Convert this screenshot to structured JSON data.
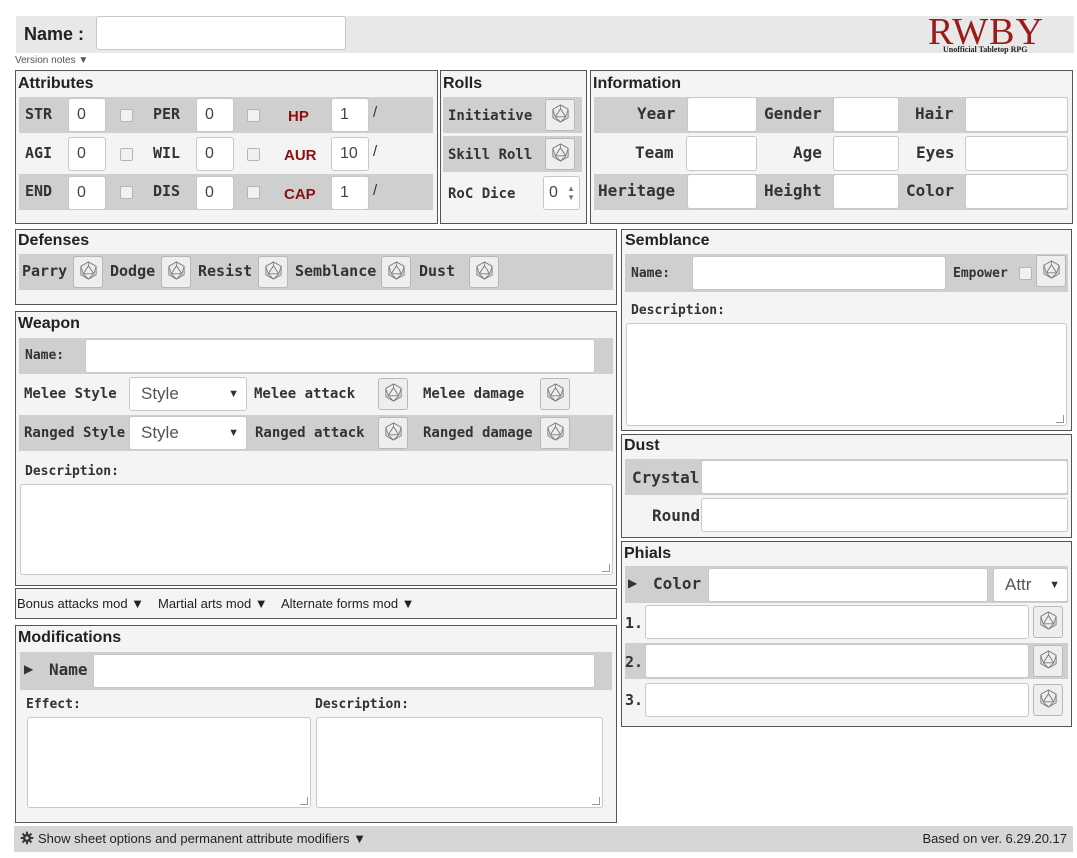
{
  "header": {
    "name_label": "Name :",
    "name_value": "",
    "version_notes": "Version notes ▼",
    "logo_text": "RWBY",
    "logo_subtext": "Unofficial Tabletop RPG"
  },
  "attributes": {
    "title": "Attributes",
    "rows": [
      {
        "a": "STR",
        "a_val": "0",
        "b": "PER",
        "b_val": "0",
        "c": "HP",
        "c_val": "1",
        "sep": "/"
      },
      {
        "a": "AGI",
        "a_val": "0",
        "b": "WIL",
        "b_val": "0",
        "c": "AUR",
        "c_val": "10",
        "sep": "/"
      },
      {
        "a": "END",
        "a_val": "0",
        "b": "DIS",
        "b_val": "0",
        "c": "CAP",
        "c_val": "1",
        "sep": "/"
      }
    ]
  },
  "rolls": {
    "title": "Rolls",
    "initiative": "Initiative",
    "skill_roll": "Skill Roll",
    "roc_dice": "RoC Dice",
    "roc_value": "0"
  },
  "information": {
    "title": "Information",
    "labels": [
      "Year",
      "Gender",
      "Hair",
      "Team",
      "Age",
      "Eyes",
      "Heritage",
      "Height",
      "Color"
    ]
  },
  "defenses": {
    "title": "Defenses",
    "items": [
      "Parry",
      "Dodge",
      "Resist",
      "Semblance",
      "Dust"
    ]
  },
  "semblance": {
    "title": "Semblance",
    "name_label": "Name:",
    "empower_label": "Empower",
    "description_label": "Description:"
  },
  "weapon": {
    "title": "Weapon",
    "name_label": "Name:",
    "melee_style": "Melee Style",
    "melee_style_value": "Style",
    "melee_attack": "Melee attack",
    "melee_damage": "Melee damage",
    "ranged_style": "Ranged Style",
    "ranged_style_value": "Style",
    "ranged_attack": "Ranged attack",
    "ranged_damage": "Ranged damage",
    "description_label": "Description:"
  },
  "mods": {
    "bonus_attacks": "Bonus attacks mod ▼",
    "martial_arts": "Martial arts mod ▼",
    "alternate_forms": "Alternate forms mod ▼"
  },
  "dust": {
    "title": "Dust",
    "crystal": "Crystal",
    "round": "Round"
  },
  "phials": {
    "title": "Phials",
    "toggle": "▶",
    "color_label": "Color",
    "attr_value": "Attr",
    "rows": [
      "1.",
      "2.",
      "3."
    ]
  },
  "modifications": {
    "title": "Modifications",
    "toggle": "▶",
    "name_label": "Name",
    "effect_label": "Effect:",
    "description_label": "Description:"
  },
  "footer": {
    "options": "Show sheet options and permanent attribute modifiers ▼",
    "version": "Based on ver. 6.29.20.17"
  },
  "colors": {
    "accent_red": "#8b1010",
    "band_gray": "#cfcfcf",
    "panel_bg": "#f4f4f4"
  }
}
